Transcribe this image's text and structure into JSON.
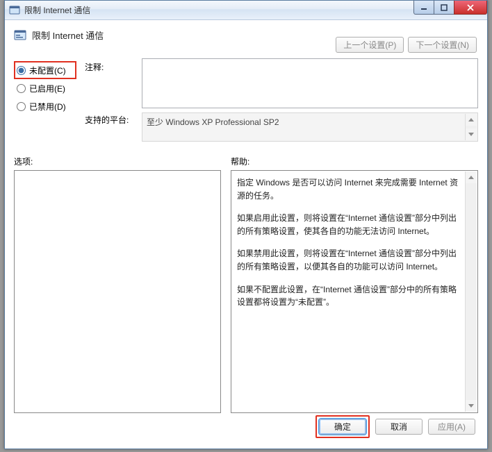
{
  "titlebar": {
    "title": "限制 Internet 通信"
  },
  "header": {
    "title": "限制 Internet 通信",
    "prev_btn": "上一个设置(P)",
    "next_btn": "下一个设置(N)"
  },
  "radios": {
    "not_configured": "未配置(C)",
    "enabled": "已启用(E)",
    "disabled": "已禁用(D)"
  },
  "labels": {
    "comment": "注释:",
    "platform": "支持的平台:",
    "options": "选项:",
    "help": "帮助:"
  },
  "platform_text": "至少 Windows XP Professional SP2",
  "help_paragraphs": [
    "指定 Windows 是否可以访问 Internet 来完成需要 Internet 资源的任务。",
    "如果启用此设置，则将设置在“Internet 通信设置”部分中列出的所有策略设置，使其各自的功能无法访问 Internet。",
    "如果禁用此设置，则将设置在“Internet 通信设置”部分中列出的所有策略设置，以便其各自的功能可以访问 Internet。",
    "如果不配置此设置，在“Internet 通信设置”部分中的所有策略设置都将设置为“未配置”。"
  ],
  "footer": {
    "ok": "确定",
    "cancel": "取消",
    "apply": "应用(A)"
  }
}
